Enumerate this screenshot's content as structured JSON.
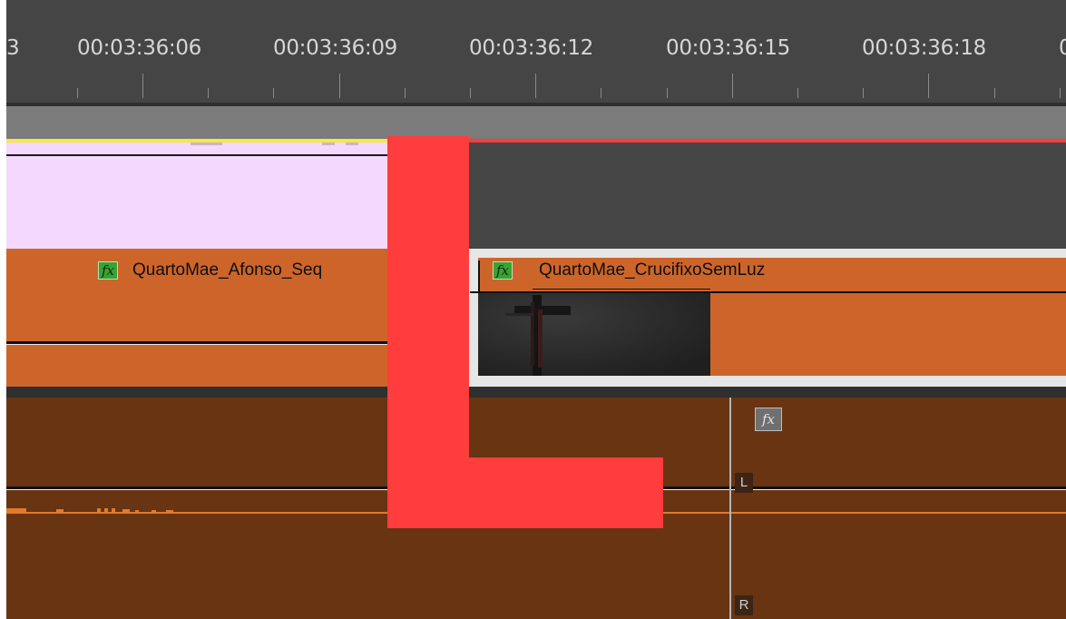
{
  "ruler": {
    "timecodes": [
      "3",
      "00:03:36:06",
      "00:03:36:09",
      "00:03:36:12",
      "00:03:36:15",
      "00:03:36:18",
      "0"
    ]
  },
  "video_track": {
    "clips": [
      {
        "name": "QuartoMae_Afonso_Seq",
        "fx_label": "fx",
        "color": "#cd652a"
      },
      {
        "name": "QuartoMae_CrucifixoSemLuz",
        "fx_label": "fx",
        "color": "#cd652a"
      }
    ],
    "overlay_clip_color": "#f4d8fd"
  },
  "audio_track": {
    "fx_label": "fx",
    "channel_left": "L",
    "channel_right": "R",
    "color": "#683412"
  },
  "overlay": {
    "shape": "L",
    "color": "#ff3d3d"
  },
  "colors": {
    "panel_bg": "#454545",
    "work_area": "#7b7b7b",
    "in_out_yellow": "#f6e845",
    "selection_red": "#ff3b3b"
  }
}
